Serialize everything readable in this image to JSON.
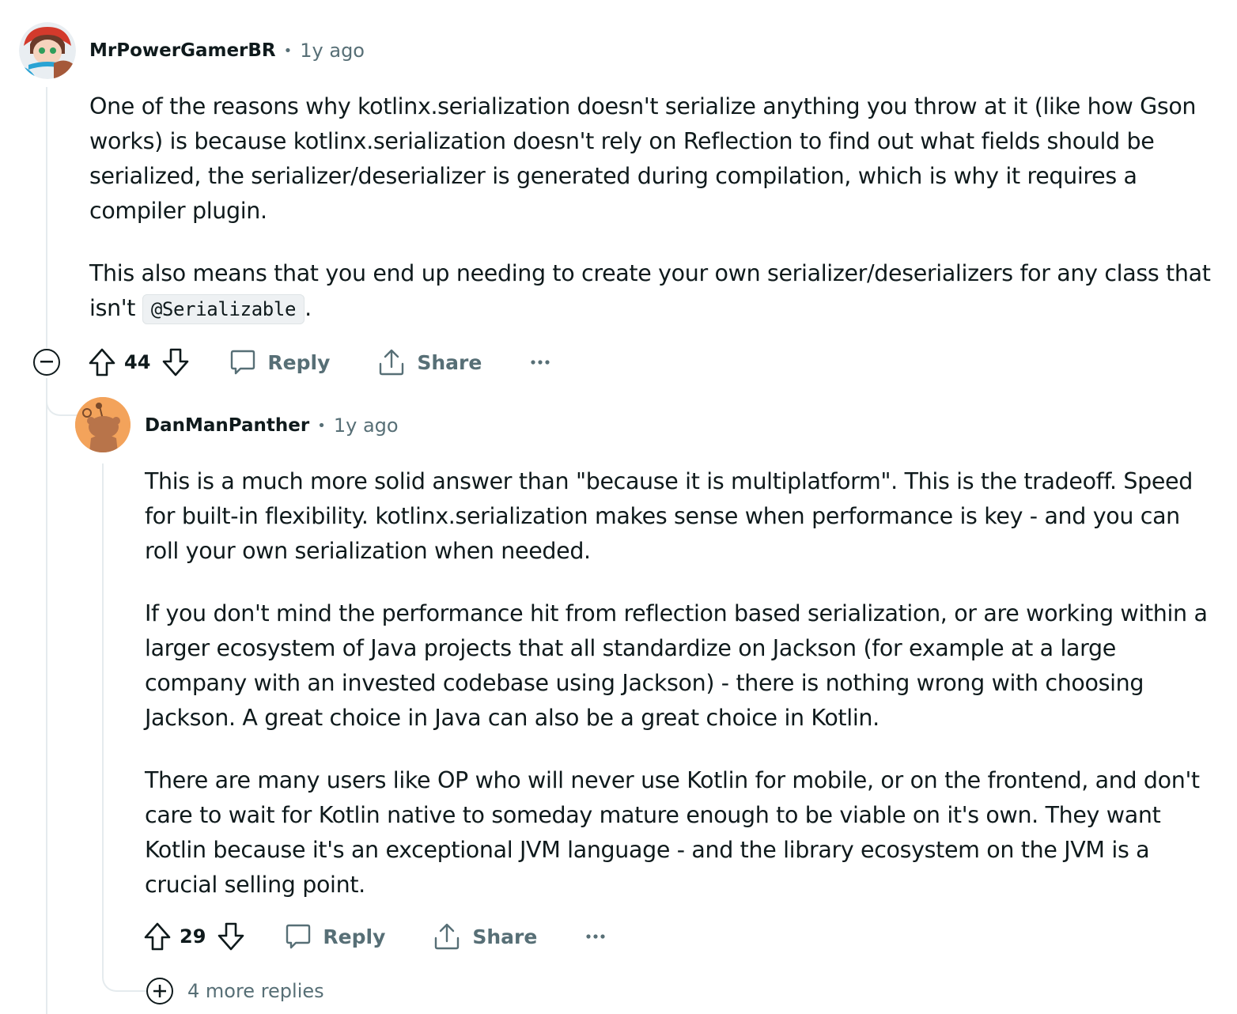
{
  "comments": [
    {
      "author": "MrPowerGamerBR",
      "separator": "•",
      "time": "1y ago",
      "paragraph1": "One of the reasons why kotlinx.serialization doesn't serialize anything you throw at it (like how Gson works) is because kotlinx.serialization doesn't rely on Reflection to find out what fields should be serialized, the serializer/deserializer is generated during compilation, which is why it requires a compiler plugin.",
      "paragraph2_before": "This also means that you end up needing to create your own serializer/deserializers for any class that isn't ",
      "paragraph2_code": "@Serializable",
      "paragraph2_after": ".",
      "score": "44",
      "reply_label": "Reply",
      "share_label": "Share"
    },
    {
      "author": "DanManPanther",
      "separator": "•",
      "time": "1y ago",
      "paragraphs": [
        "This is a much more solid answer than \"because it is multiplatform\". This is the tradeoff. Speed for built-in flexibility. kotlinx.serialization makes sense when performance is key - and you can roll your own serialization when needed.",
        "If you don't mind the performance hit from reflection based serialization, or are working within a larger ecosystem of Java projects that all standardize on Jackson (for example at a large company with an invested codebase using Jackson) - there is nothing wrong with choosing Jackson. A great choice in Java can also be a great choice in Kotlin.",
        "There are many users like OP who will never use Kotlin for mobile, or on the frontend, and don't care to wait for Kotlin native to someday mature enough to be viable on it's own. They want Kotlin because it's an exceptional JVM language - and the library ecosystem on the JVM is a crucial selling point."
      ],
      "score": "29",
      "reply_label": "Reply",
      "share_label": "Share"
    }
  ],
  "more_replies_label": "4 more replies",
  "colors": {
    "text": "#0f1a1c",
    "meta": "#576f76",
    "thread_line": "#e5ebee",
    "snoo_orange": "#f3a35b"
  }
}
